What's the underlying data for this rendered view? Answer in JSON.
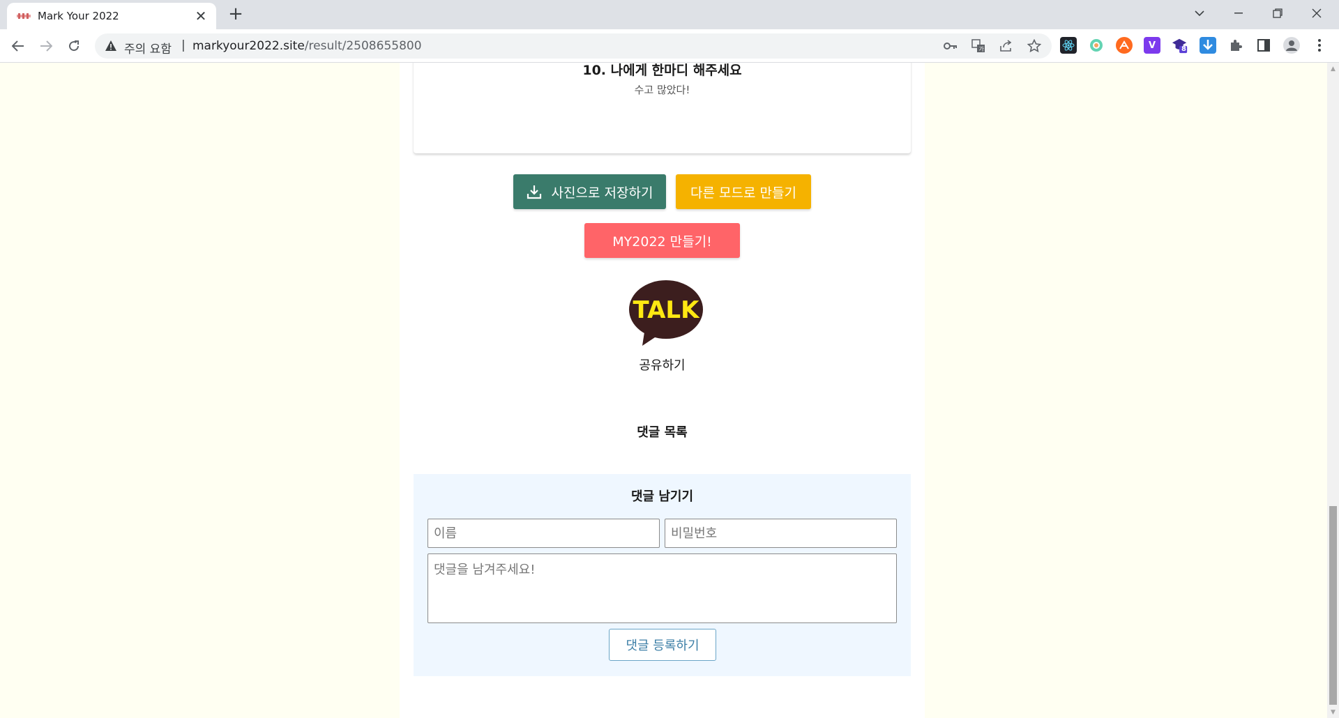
{
  "browser": {
    "tab_title": "Mark Your 2022",
    "new_tab": "+",
    "security_warning": "주의 요함",
    "separator": "|",
    "url_domain": "markyour2022.site",
    "url_path": "/result/2508655800",
    "extension_badge": "8",
    "extension_v": "V"
  },
  "card": {
    "question": "10. 나에게 한마디 해주세요",
    "answer": "수고 많았다!"
  },
  "buttons": {
    "save_image": "사진으로 저장하기",
    "other_mode": "다른 모드로 만들기",
    "make_my2022": "MY2022 만들기!"
  },
  "kakao": {
    "logo_text": "TALK",
    "share_label": "공유하기"
  },
  "comments": {
    "list_title": "댓글 목록",
    "form_title": "댓글 남기기",
    "name_placeholder": "이름",
    "password_placeholder": "비밀번호",
    "comment_placeholder": "댓글을 남겨주세요!",
    "submit_label": "댓글 등록하기"
  },
  "colors": {
    "save_button": "#3a7b6b",
    "mode_button": "#f5b200",
    "make_button": "#ff6468",
    "kakao_bubble": "#3c1e1e",
    "kakao_text": "#ffe812",
    "comment_bg": "#eff7ff",
    "page_bg": "#fffff2"
  }
}
